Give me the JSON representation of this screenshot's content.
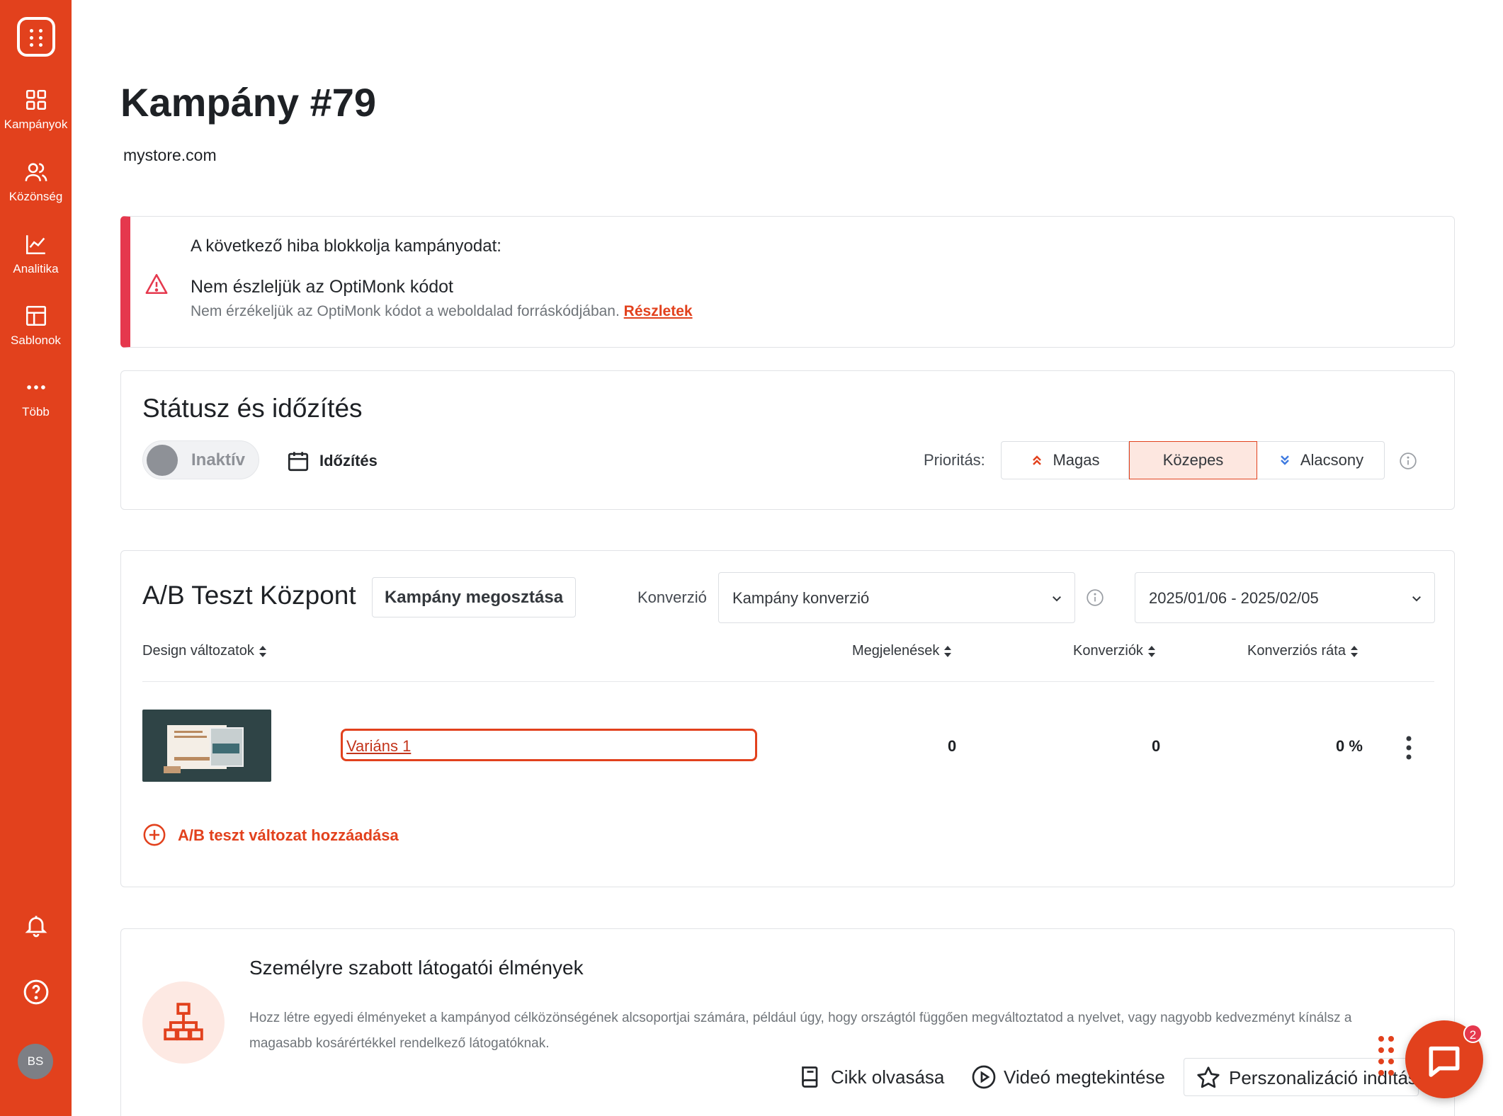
{
  "sidebar": {
    "items": [
      {
        "label": "Kampányok",
        "icon": "grid-icon"
      },
      {
        "label": "Közönség",
        "icon": "users-icon"
      },
      {
        "label": "Analitika",
        "icon": "chart-icon"
      },
      {
        "label": "Sablonok",
        "icon": "layout-icon"
      },
      {
        "label": "Több",
        "icon": "more-icon"
      }
    ],
    "avatar": "BS",
    "bg_color": "#e2411d"
  },
  "header": {
    "title": "Kampány #79",
    "domain": "mystore.com"
  },
  "alert": {
    "heading": "A következő hiba blokkolja kampányodat:",
    "title": "Nem észleljük az OptiMonk kódot",
    "description": "Nem érzékeljük az OptiMonk kódot a weboldalad forráskódjában.",
    "link": "Részletek",
    "accent": "#e5384d"
  },
  "status": {
    "title": "Státusz és időzítés",
    "toggle_label": "Inaktív",
    "timing_label": "Időzítés",
    "priority_label": "Prioritás:",
    "priority_options": [
      "Magas",
      "Közepes",
      "Alacsony"
    ],
    "priority_selected": "Közepes"
  },
  "ab_test": {
    "title": "A/B Teszt Központ",
    "share_button": "Kampány megosztása",
    "conversion_label": "Konverzió",
    "conversion_select": "Kampány konverzió",
    "date_range": "2025/01/06 - 2025/02/05",
    "columns": [
      "Design változatok",
      "Megjelenések",
      "Konverziók",
      "Konverziós ráta"
    ],
    "rows": [
      {
        "name": "Variáns 1",
        "impressions": "0",
        "conversions": "0",
        "rate": "0 %"
      }
    ],
    "add_variant": "A/B teszt változat hozzáadása"
  },
  "personalization": {
    "title": "Személyre szabott látogatói élmények",
    "description": "Hozz létre egyedi élményeket a kampányod célközönségének alcsoportjai számára, például úgy, hogy országtól függően megváltoztatod a nyelvet, vagy nagyobb kedvezményt kínálsz a magasabb kosárértékkel rendelkező látogatóknak.",
    "read_article": "Cikk olvasása",
    "watch_video": "Videó megtekintése",
    "start": "Perszonalizáció indítása"
  },
  "chat": {
    "badge": "2"
  }
}
